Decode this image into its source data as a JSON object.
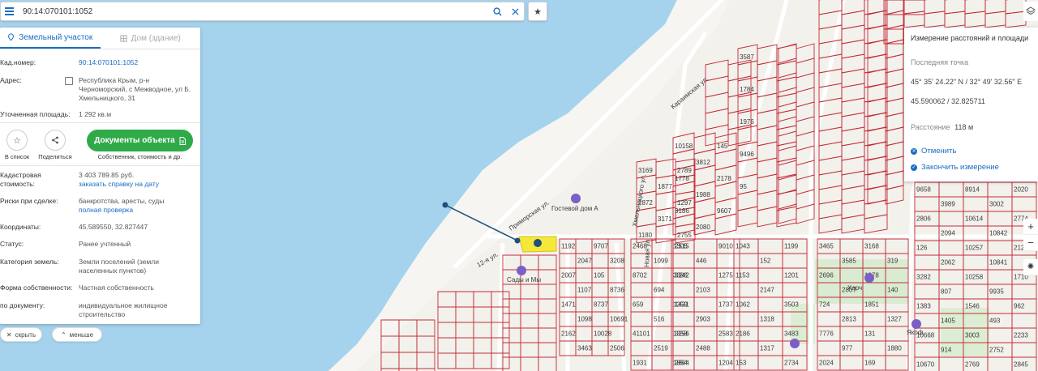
{
  "search": {
    "value": "90:14:070101:1052"
  },
  "panel": {
    "tabs": [
      {
        "label": "Земельный участок"
      },
      {
        "label": "Дом (здание)"
      }
    ],
    "fields": {
      "cad_num_label": "Кад.номер:",
      "cad_num_value": "90:14:070101:1052",
      "address_label": "Адрес:",
      "address_line1": "Республика Крым, р-н",
      "address_line2": "Черноморский, с Межводное, ул Б.",
      "address_line3": "Хмельницкого, 31",
      "area_label": "Уточненная площадь:",
      "area_value": "1 292 кв.м",
      "cost_label1": "Кадастровая",
      "cost_label2": "стоимость:",
      "cost_value": "3 403 789.85 руб.",
      "cost_link": "заказать справку на дату",
      "risk_label": "Риски при сделке:",
      "risk_value": "банкротства, аресты, суды",
      "risk_link": "полная проверка",
      "coords_label": "Координаты:",
      "coords_value": "45.589550, 32.827447",
      "status_label": "Статус:",
      "status_value": "Ранее учтенный",
      "category_label": "Категория земель:",
      "category_line1": "Земли поселений (земли",
      "category_line2": "населенных пунктов)",
      "ownership_label": "Форма собственности:",
      "ownership_value": "Частная собственность",
      "bydoc_label": "по документу:",
      "bydoc_line1": "индивидуальное жилищное",
      "bydoc_line2": "строительство"
    },
    "actions": {
      "to_list": "В список",
      "share": "Поделиться",
      "docs_button": "Документы объекта",
      "docs_sub": "Собственник, стоимость и др."
    }
  },
  "pills": {
    "hide": "скрыть",
    "less": "меньше"
  },
  "measurement": {
    "title": "Измерение расстояний и площади",
    "last_point_label": "Последняя точка",
    "dms": "45° 35' 24.22\" N / 32° 49' 32.56\" E",
    "decimal": "45.590062 / 32.825711",
    "distance_label": "Расстояние",
    "distance_value": "118 м",
    "cancel": "Отменить",
    "finish": "Закончить измерение"
  },
  "zoom": {
    "in": "+",
    "out": "−"
  },
  "map_labels": {
    "streets": [
      "Приморская ул.",
      "Гостевой дом А",
      "Хмельницкого ул.",
      "Караимская ул.",
      "Новая ул.",
      "Харч",
      "Сады и Мы",
      "Якоф",
      "12-я ул."
    ],
    "plots": [
      "1192",
      "2007",
      "1471",
      "2162",
      "2047",
      "1107",
      "1098",
      "3463",
      "9707",
      "105",
      "8737",
      "10028",
      "3208",
      "8736",
      "10691",
      "2506",
      "2468",
      "8702",
      "659",
      "41101",
      "1931",
      "1099",
      "694",
      "516",
      "2519",
      "2515",
      "3242",
      "1431",
      "3256",
      "2864",
      "1305",
      "3386",
      "1359",
      "1358",
      "1854",
      "446",
      "2103",
      "2903",
      "2488",
      "9010",
      "1275",
      "1737",
      "2583",
      "1204",
      "1043",
      "1153",
      "1062",
      "2186",
      "153",
      "152",
      "2147",
      "1318",
      "1317",
      "1199",
      "1201",
      "3503",
      "3483",
      "2734",
      "3465",
      "2696",
      "724",
      "7776",
      "2024",
      "3585",
      "2807",
      "2813",
      "977",
      "3168",
      "1978",
      "1851",
      "131",
      "169",
      "319",
      "140",
      "1327",
      "1880",
      "9658",
      "2806",
      "126",
      "3282",
      "1383",
      "10668",
      "10670",
      "3989",
      "2094",
      "2062",
      "807",
      "1405",
      "914",
      "8914",
      "10614",
      "10257",
      "10258",
      "1546",
      "3003",
      "2769",
      "3002",
      "10842",
      "10841",
      "9935",
      "493",
      "2752",
      "2020",
      "2774",
      "2129",
      "1710",
      "962",
      "2233",
      "2845",
      "3169",
      "2872",
      "1180",
      "1877",
      "3171",
      "2789",
      "1297",
      "2755",
      "10158",
      "1778",
      "3186",
      "3812",
      "1988",
      "2080",
      "145",
      "2178",
      "9607",
      "3587",
      "1784",
      "1976",
      "9496",
      "95"
    ]
  }
}
